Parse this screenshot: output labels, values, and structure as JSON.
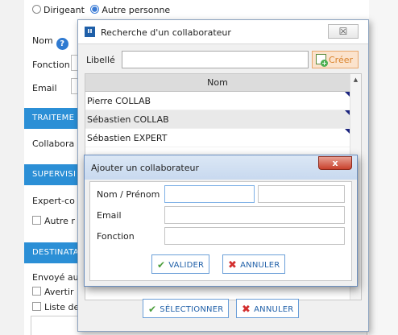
{
  "background": {
    "radio_dirigeant": "Dirigeant",
    "radio_autre": "Autre personne",
    "nom_label": "Nom",
    "fonction_label": "Fonction",
    "email_label": "Email",
    "section_traitement": "TRAITEME",
    "collaborateur_label": "Collabora",
    "section_supervision": "SUPERVISI",
    "expert_label": "Expert-co",
    "autre_check_label": "Autre r",
    "section_destinataires": "DESTINATA",
    "envoye_label": "Envoyé au",
    "avertir_label": "Avertir",
    "liste_label": "Liste de"
  },
  "search_dialog": {
    "title": "Recherche d'un collaborateur",
    "close_glyph": "☒",
    "libelle_label": "Libellé",
    "libelle_value": "",
    "creer_label": "Créer",
    "column_nom": "Nom",
    "rows": [
      {
        "nom": "Pierre COLLAB"
      },
      {
        "nom": "Sébastien COLLAB"
      },
      {
        "nom": "Sébastien EXPERT"
      }
    ],
    "selectionner_label": "SÉLECTIONNER",
    "annuler_label": "ANNULER"
  },
  "add_dialog": {
    "title": "Ajouter un collaborateur",
    "close_glyph": "x",
    "nom_prenom_label": "Nom / Prénom",
    "nom_value": "",
    "prenom_value": "",
    "email_label": "Email",
    "email_value": "",
    "fonction_label": "Fonction",
    "fonction_value": "",
    "valider_label": "VALIDER",
    "annuler_label": "ANNULER"
  },
  "colors": {
    "section_blue": "#2b8fd6",
    "button_text_blue": "#1f5fa8",
    "check_green": "#4a9d3a",
    "cross_red": "#d32f2f",
    "creer_orange": "#d9822b"
  },
  "icons": {
    "help": "?",
    "check": "✔",
    "cross": "✖",
    "scroll_up": "▲"
  }
}
